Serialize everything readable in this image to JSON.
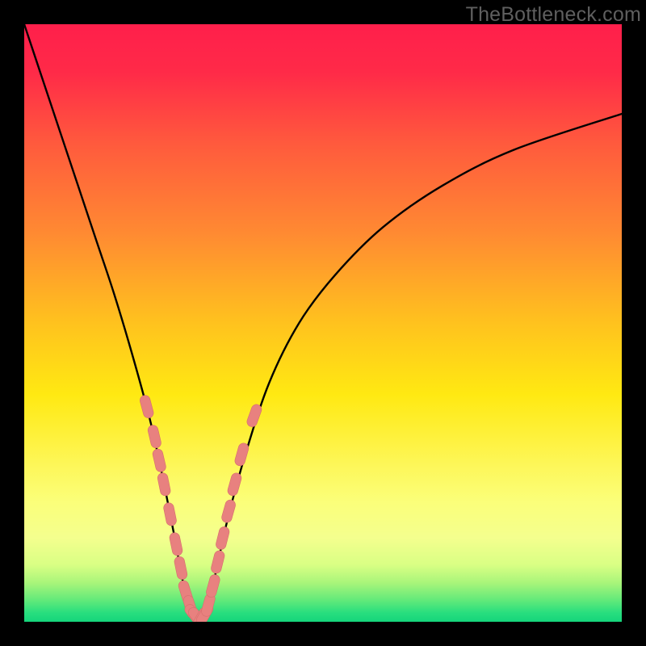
{
  "watermark": "TheBottleneck.com",
  "colors": {
    "black": "#000000",
    "curve": "#000000",
    "marker_fill": "#e8817f",
    "marker_stroke": "#d66e6c",
    "gradient_stops": [
      {
        "offset": 0.0,
        "color": "#ff1f4b"
      },
      {
        "offset": 0.08,
        "color": "#ff2a48"
      },
      {
        "offset": 0.2,
        "color": "#ff5a3d"
      },
      {
        "offset": 0.35,
        "color": "#ff8a32"
      },
      {
        "offset": 0.5,
        "color": "#ffc21e"
      },
      {
        "offset": 0.62,
        "color": "#ffe912"
      },
      {
        "offset": 0.74,
        "color": "#fdf75a"
      },
      {
        "offset": 0.8,
        "color": "#fbff7a"
      },
      {
        "offset": 0.86,
        "color": "#f4ff8e"
      },
      {
        "offset": 0.905,
        "color": "#d9ff84"
      },
      {
        "offset": 0.935,
        "color": "#a8f57a"
      },
      {
        "offset": 0.965,
        "color": "#5fe97a"
      },
      {
        "offset": 0.985,
        "color": "#28de7e"
      },
      {
        "offset": 1.0,
        "color": "#15d57b"
      }
    ]
  },
  "chart_data": {
    "type": "line",
    "title": "",
    "xlabel": "",
    "ylabel": "",
    "xlim": [
      0,
      100
    ],
    "ylim": [
      0,
      100
    ],
    "note": "Values are approximate mismatch/bottleneck percentages read from the plot. x is a normalized horizontal position (0–100); y is the mismatch percentage (0 = perfect match at the curve minimum, 100 = worst).",
    "series": [
      {
        "name": "bottleneck-curve",
        "x": [
          0,
          3,
          6,
          9,
          12,
          15,
          18,
          21,
          23,
          25,
          26.5,
          28,
          29.5,
          30.5,
          32,
          34,
          37,
          41,
          46,
          52,
          60,
          70,
          82,
          100
        ],
        "y": [
          100,
          91,
          82,
          73,
          64,
          55,
          45,
          34,
          25,
          15,
          7,
          1,
          0.5,
          2,
          8,
          17,
          28,
          40,
          50,
          58,
          66,
          73,
          79,
          85
        ]
      }
    ],
    "markers": {
      "name": "highlighted-points",
      "note": "Pink dash/dot markers clustered near the curve minimum on both branches.",
      "points": [
        {
          "x": 20.5,
          "y": 36
        },
        {
          "x": 21.8,
          "y": 31
        },
        {
          "x": 22.6,
          "y": 27
        },
        {
          "x": 23.4,
          "y": 23
        },
        {
          "x": 24.4,
          "y": 18
        },
        {
          "x": 25.4,
          "y": 13
        },
        {
          "x": 26.2,
          "y": 9
        },
        {
          "x": 27.0,
          "y": 5
        },
        {
          "x": 27.8,
          "y": 2.5
        },
        {
          "x": 28.4,
          "y": 1.2
        },
        {
          "x": 29.0,
          "y": 0.7
        },
        {
          "x": 29.6,
          "y": 0.6
        },
        {
          "x": 30.2,
          "y": 1.2
        },
        {
          "x": 30.8,
          "y": 2.8
        },
        {
          "x": 31.6,
          "y": 6
        },
        {
          "x": 32.4,
          "y": 10
        },
        {
          "x": 33.2,
          "y": 14
        },
        {
          "x": 34.2,
          "y": 18.5
        },
        {
          "x": 35.2,
          "y": 23
        },
        {
          "x": 36.4,
          "y": 28
        },
        {
          "x": 38.5,
          "y": 34.5
        }
      ]
    }
  }
}
